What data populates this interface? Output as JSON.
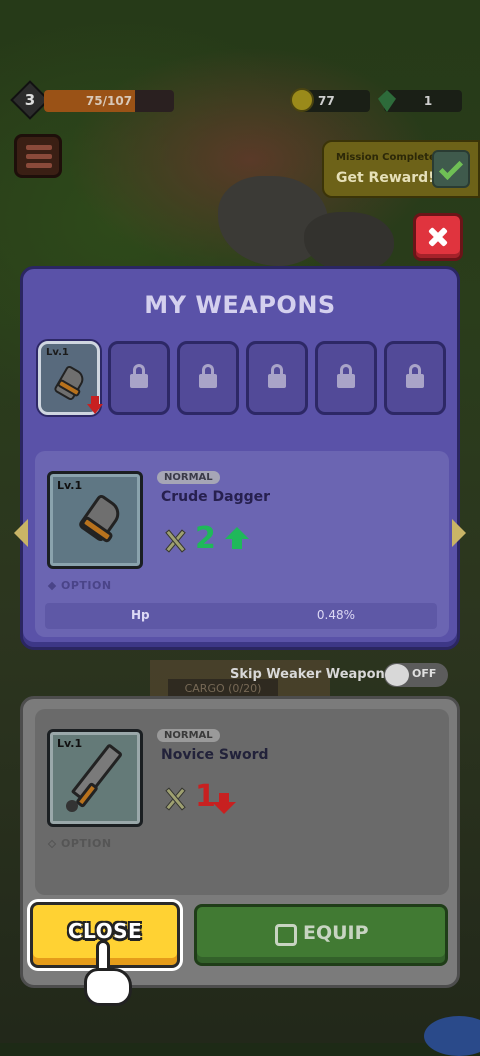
{
  "hud": {
    "level": "3",
    "xp_text": "75/107",
    "xp_progress": 0.7,
    "coins": "77",
    "gems": "1",
    "mission_label": "Mission Complete",
    "mission_cta": "Get Reward!"
  },
  "panel": {
    "title": "MY WEAPONS",
    "slots": [
      {
        "level": "Lv.1",
        "locked": false,
        "active": true,
        "downgrade": true
      },
      {
        "locked": true
      },
      {
        "locked": true
      },
      {
        "locked": true
      },
      {
        "locked": true
      },
      {
        "locked": true
      }
    ],
    "selected": {
      "level": "Lv.1",
      "rarity": "NORMAL",
      "name": "Crude Dagger",
      "power": "2",
      "trend": "up",
      "option_label": "OPTION",
      "stat_name": "Hp",
      "stat_value": "0.48%"
    }
  },
  "skip": {
    "label": "Skip Weaker Weapon",
    "toggle": "OFF"
  },
  "background_text": "CARGO (0/20)",
  "equipped": {
    "level": "Lv.1",
    "rarity": "NORMAL",
    "name": "Novice Sword",
    "power": "1",
    "trend": "down",
    "option_label": "OPTION"
  },
  "buttons": {
    "close": "CLOSE",
    "equip": "EQUIP"
  },
  "colors": {
    "panel": "#5a52a8",
    "close_button": "#ffd233",
    "equip_button": "#417a33",
    "x_button": "#e0343e",
    "power_up": "#1fb85a",
    "power_down": "#c82020"
  }
}
